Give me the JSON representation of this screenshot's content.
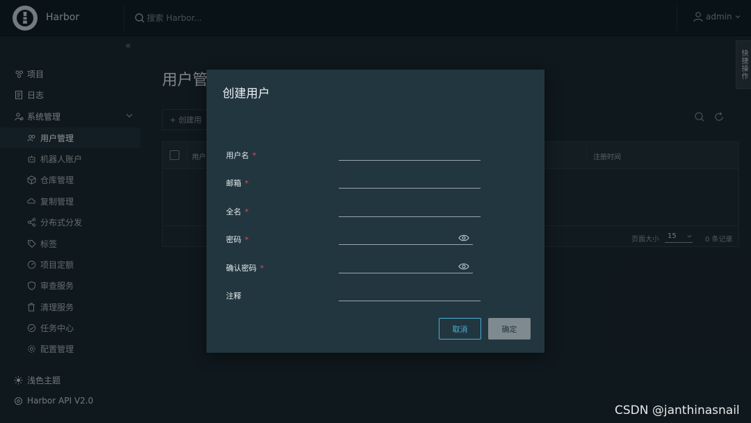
{
  "header": {
    "app_title": "Harbor",
    "search_placeholder": "搜索 Harbor...",
    "user": "admin"
  },
  "sidebar": {
    "items": [
      {
        "label": "项目",
        "icon": "projects-icon"
      },
      {
        "label": "日志",
        "icon": "logs-icon"
      },
      {
        "label": "系统管理",
        "icon": "admin-icon"
      }
    ],
    "sub_items": [
      {
        "label": "用户管理",
        "icon": "users-icon"
      },
      {
        "label": "机器人账户",
        "icon": "robot-icon"
      },
      {
        "label": "仓库管理",
        "icon": "registry-icon"
      },
      {
        "label": "复制管理",
        "icon": "replication-icon"
      },
      {
        "label": "分布式分发",
        "icon": "distribution-icon"
      },
      {
        "label": "标签",
        "icon": "tag-icon"
      },
      {
        "label": "项目定额",
        "icon": "quota-icon"
      },
      {
        "label": "审查服务",
        "icon": "shield-icon"
      },
      {
        "label": "清理服务",
        "icon": "trash-icon"
      },
      {
        "label": "任务中心",
        "icon": "job-icon"
      },
      {
        "label": "配置管理",
        "icon": "gear-icon"
      }
    ],
    "footer": {
      "theme_label": "浅色主题",
      "api_label": "Harbor API V2.0"
    }
  },
  "main": {
    "page_title": "用户管",
    "create_button": "+ 创建用",
    "columns": [
      "用户",
      "注册时间"
    ],
    "footer": {
      "page_size_label": "页面大小",
      "page_size": "15",
      "record_count": "0 条记录"
    }
  },
  "side_tab": "快捷操作",
  "modal": {
    "title": "创建用户",
    "fields": [
      {
        "label": "用户名",
        "required": true
      },
      {
        "label": "邮箱",
        "required": true
      },
      {
        "label": "全名",
        "required": true
      },
      {
        "label": "密码",
        "required": true
      },
      {
        "label": "确认密码",
        "required": true
      },
      {
        "label": "注释",
        "required": false
      }
    ],
    "required_mark": "*",
    "cancel_label": "取消",
    "ok_label": "确定"
  },
  "watermark": "CSDN @janthinasnail",
  "colors": {
    "accent": "#49afd9",
    "required": "#e05050",
    "modal_bg": "#223640",
    "header_bg": "#0f1f28"
  }
}
